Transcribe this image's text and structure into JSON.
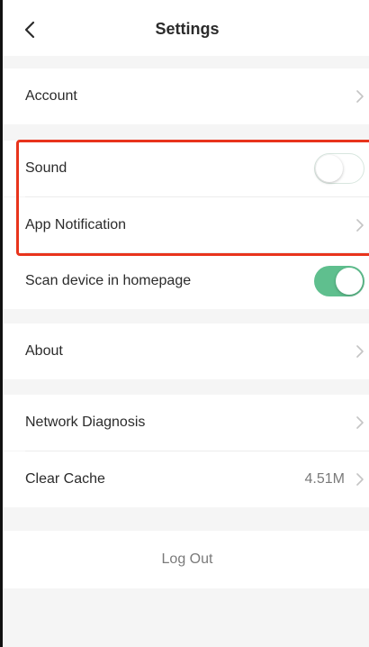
{
  "header": {
    "title": "Settings",
    "back_icon": "chevron-left-icon"
  },
  "settings": {
    "account": {
      "label": "Account"
    },
    "sound": {
      "label": "Sound",
      "enabled": false
    },
    "app_notification": {
      "label": "App Notification"
    },
    "scan_device": {
      "label": "Scan device in homepage",
      "enabled": true
    },
    "about": {
      "label": "About"
    },
    "network_diagnosis": {
      "label": "Network Diagnosis"
    },
    "clear_cache": {
      "label": "Clear Cache",
      "value": "4.51M"
    }
  },
  "logout": {
    "label": "Log Out"
  },
  "colors": {
    "toggle_on": "#5fbf8e",
    "highlight": "#e8341c",
    "background": "#f5f5f5"
  }
}
